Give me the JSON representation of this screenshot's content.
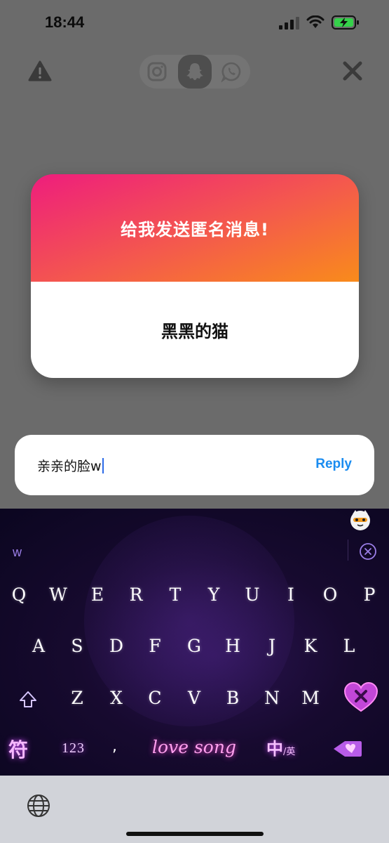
{
  "status_bar": {
    "time": "18:44"
  },
  "top_bar": {
    "icons": [
      "warning-icon",
      "instagram-icon",
      "snapchat-icon",
      "whatsapp-icon",
      "close-icon"
    ],
    "active_share": "snapchat"
  },
  "card": {
    "prompt": "给我发送匿名消息!",
    "message": "黑黑的猫",
    "gradient": [
      "#ee1d7d",
      "#f98b1b"
    ]
  },
  "reply": {
    "value": "亲亲的脸w",
    "button_label": "Reply",
    "accent": "#1a8cf0"
  },
  "keyboard": {
    "candidate": "w",
    "rows": [
      [
        "Q",
        "W",
        "E",
        "R",
        "T",
        "Y",
        "U",
        "I",
        "O",
        "P"
      ],
      [
        "A",
        "S",
        "D",
        "F",
        "G",
        "H",
        "J",
        "K",
        "L"
      ],
      [
        "Z",
        "X",
        "C",
        "V",
        "B",
        "N",
        "M"
      ]
    ],
    "symbols_label": "符",
    "numbers_label": "123",
    "comma_label": ",",
    "space_label": "love song",
    "lang_label": "中",
    "lang_sub": "/英"
  }
}
